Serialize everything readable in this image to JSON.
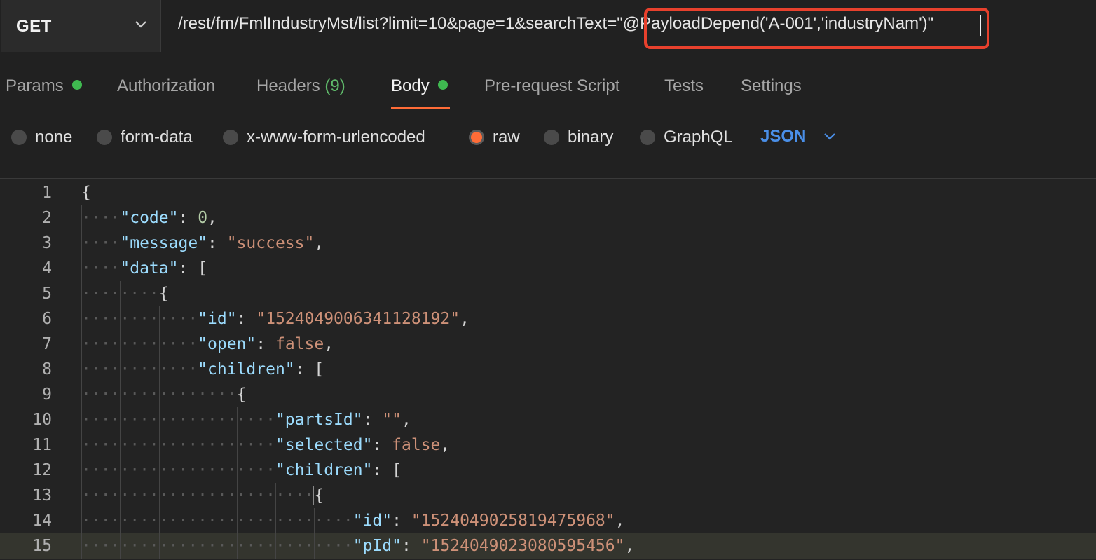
{
  "request": {
    "method": "GET",
    "url_prefix": "/rest/fm/FmlIndustryMst/list?limit=10&page=1&searchText=",
    "url_highlighted": "\"@PayloadDepend('A-001','industryNam')\""
  },
  "tabs": [
    {
      "label": "Params",
      "indicator": "green-dot"
    },
    {
      "label": "Authorization"
    },
    {
      "label": "Headers",
      "count": "(9)"
    },
    {
      "label": "Body",
      "indicator": "green-dot",
      "active": true
    },
    {
      "label": "Pre-request Script"
    },
    {
      "label": "Tests"
    },
    {
      "label": "Settings"
    }
  ],
  "body_types": [
    {
      "label": "none",
      "checked": false
    },
    {
      "label": "form-data",
      "checked": false
    },
    {
      "label": "x-www-form-urlencoded",
      "checked": false
    },
    {
      "label": "raw",
      "checked": true
    },
    {
      "label": "binary",
      "checked": false
    },
    {
      "label": "GraphQL",
      "checked": false
    }
  ],
  "format_select": {
    "value": "JSON"
  },
  "editor": {
    "current_line": 15,
    "lines": [
      {
        "n": "1",
        "indent": 0,
        "tokens": [
          [
            "p",
            "{"
          ]
        ]
      },
      {
        "n": "2",
        "indent": 1,
        "tokens": [
          [
            "k",
            "\"code\""
          ],
          [
            "p",
            ": "
          ],
          [
            "n",
            "0"
          ],
          [
            "p",
            ","
          ]
        ]
      },
      {
        "n": "3",
        "indent": 1,
        "tokens": [
          [
            "k",
            "\"message\""
          ],
          [
            "p",
            ": "
          ],
          [
            "s",
            "\"success\""
          ],
          [
            "p",
            ","
          ]
        ]
      },
      {
        "n": "4",
        "indent": 1,
        "tokens": [
          [
            "k",
            "\"data\""
          ],
          [
            "p",
            ": ["
          ]
        ]
      },
      {
        "n": "5",
        "indent": 2,
        "tokens": [
          [
            "p",
            "{"
          ]
        ]
      },
      {
        "n": "6",
        "indent": 3,
        "tokens": [
          [
            "k",
            "\"id\""
          ],
          [
            "p",
            ": "
          ],
          [
            "s",
            "\"1524049006341128192\""
          ],
          [
            "p",
            ","
          ]
        ]
      },
      {
        "n": "7",
        "indent": 3,
        "tokens": [
          [
            "k",
            "\"open\""
          ],
          [
            "p",
            ": "
          ],
          [
            "s",
            "false"
          ],
          [
            "p",
            ","
          ]
        ]
      },
      {
        "n": "8",
        "indent": 3,
        "tokens": [
          [
            "k",
            "\"children\""
          ],
          [
            "p",
            ": ["
          ]
        ]
      },
      {
        "n": "9",
        "indent": 4,
        "tokens": [
          [
            "p",
            "{"
          ]
        ]
      },
      {
        "n": "10",
        "indent": 5,
        "tokens": [
          [
            "k",
            "\"partsId\""
          ],
          [
            "p",
            ": "
          ],
          [
            "s",
            "\"\""
          ],
          [
            "p",
            ","
          ]
        ]
      },
      {
        "n": "11",
        "indent": 5,
        "tokens": [
          [
            "k",
            "\"selected\""
          ],
          [
            "p",
            ": "
          ],
          [
            "s",
            "false"
          ],
          [
            "p",
            ","
          ]
        ]
      },
      {
        "n": "12",
        "indent": 5,
        "tokens": [
          [
            "k",
            "\"children\""
          ],
          [
            "p",
            ": ["
          ]
        ]
      },
      {
        "n": "13",
        "indent": 6,
        "tokens": [
          [
            "p",
            "{"
          ]
        ]
      },
      {
        "n": "14",
        "indent": 7,
        "tokens": [
          [
            "k",
            "\"id\""
          ],
          [
            "p",
            ": "
          ],
          [
            "s",
            "\"1524049025819475968\""
          ],
          [
            "p",
            ","
          ]
        ]
      },
      {
        "n": "15",
        "indent": 7,
        "tokens": [
          [
            "k",
            "\"pId\""
          ],
          [
            "p",
            ": "
          ],
          [
            "s",
            "\"1524049023080595456\""
          ],
          [
            "p",
            ","
          ]
        ]
      }
    ]
  }
}
